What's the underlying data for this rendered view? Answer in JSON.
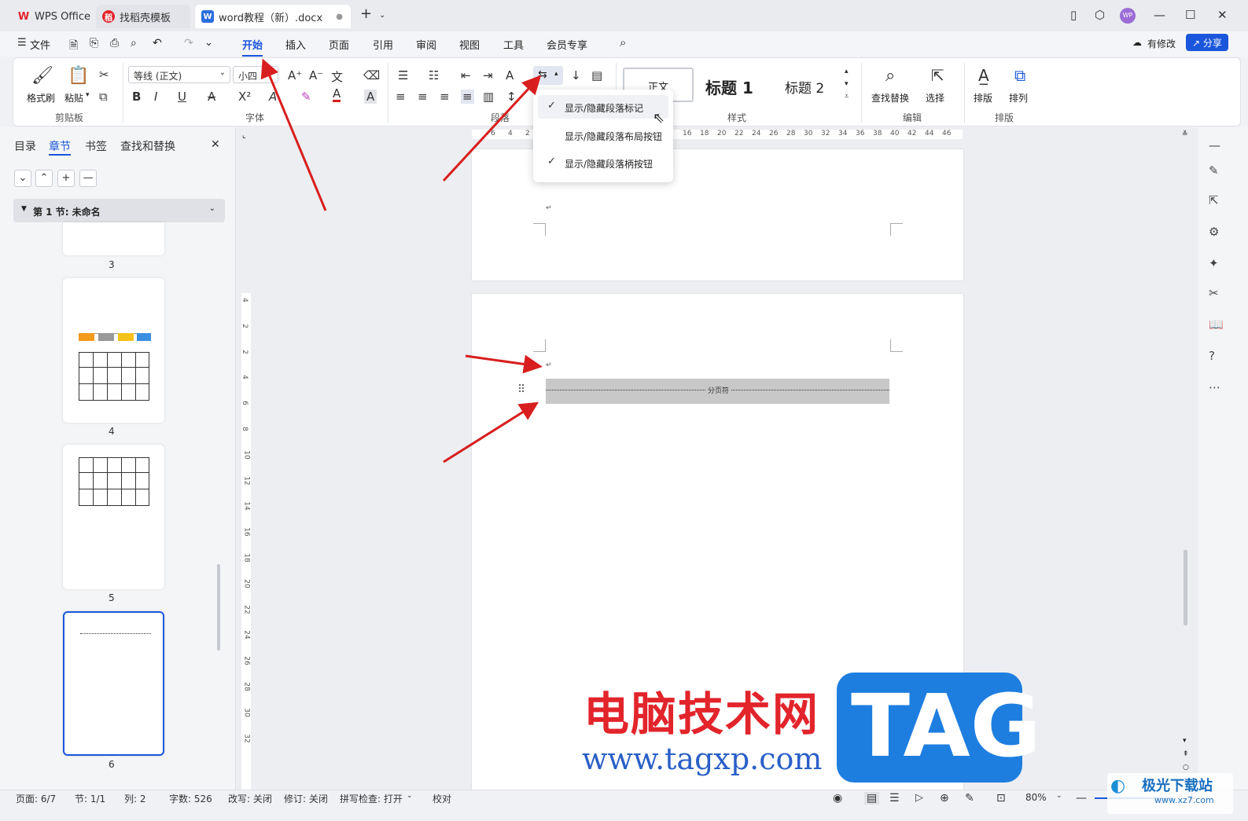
{
  "tabs": [
    {
      "label": "WPS Office"
    },
    {
      "label": "找稻壳模板"
    },
    {
      "label": "word教程（新）.docx"
    }
  ],
  "menu": {
    "file": "文件",
    "items": [
      "开始",
      "插入",
      "页面",
      "引用",
      "审阅",
      "视图",
      "工具",
      "会员专享"
    ],
    "modify": "有修改",
    "share": "分享"
  },
  "ribbon": {
    "format_painter": "格式刷",
    "paste": "粘贴",
    "font_name": "等线 (正文)",
    "font_size": "小四",
    "styles": [
      "正文",
      "标题 1",
      "标题 2"
    ],
    "find_replace": "查找替换",
    "select": "选择",
    "layout": "排版",
    "arrange": "排列",
    "groups": {
      "clipboard": "剪贴板",
      "font": "字体",
      "paragraph": "段落",
      "styles": "样式",
      "edit": "编辑",
      "layout": "排版"
    }
  },
  "left_panel": {
    "tabs": [
      "目录",
      "章节",
      "书签",
      "查找和替换"
    ],
    "section": "第 1 节: 未命名",
    "pages": [
      "3",
      "4",
      "5",
      "6"
    ]
  },
  "dropdown": {
    "items": [
      {
        "label": "显示/隐藏段落标记",
        "checked": true
      },
      {
        "label": "显示/隐藏段落布局按钮",
        "checked": false
      },
      {
        "label": "显示/隐藏段落柄按钮",
        "checked": true
      }
    ]
  },
  "ruler": {
    "h_ticks": [
      "6",
      "4",
      "2",
      "16",
      "18",
      "20",
      "22",
      "24",
      "26",
      "28",
      "30",
      "32",
      "34",
      "36",
      "38",
      "40",
      "42",
      "44",
      "46"
    ],
    "v_ticks": [
      "4",
      "2",
      "2",
      "4",
      "6",
      "8",
      "10",
      "12",
      "14",
      "16",
      "18",
      "20",
      "22",
      "24",
      "26",
      "28",
      "30",
      "32"
    ]
  },
  "document": {
    "page_break": "分页符",
    "para_mark": "↵"
  },
  "status": {
    "page": "页面: 6/7",
    "section": "节: 1/1",
    "column": "列: 2",
    "words": "字数: 526",
    "revise_mode": "改写: 关闭",
    "track": "修订: 关闭",
    "spell": "拼写检查: 打开",
    "proof": "校对",
    "zoom": "80%"
  },
  "watermark": {
    "cn_text": "电脑技术网",
    "url": "www.tagxp.com",
    "tag": "TAG",
    "corner_text": "极光下载站",
    "corner_url": "www.xz7.com"
  },
  "colors": {
    "accent": "#1a56db",
    "arrow": "#d81e1e",
    "watermark_red": "#e2242b",
    "tag_blue": "#1e7ee0"
  }
}
